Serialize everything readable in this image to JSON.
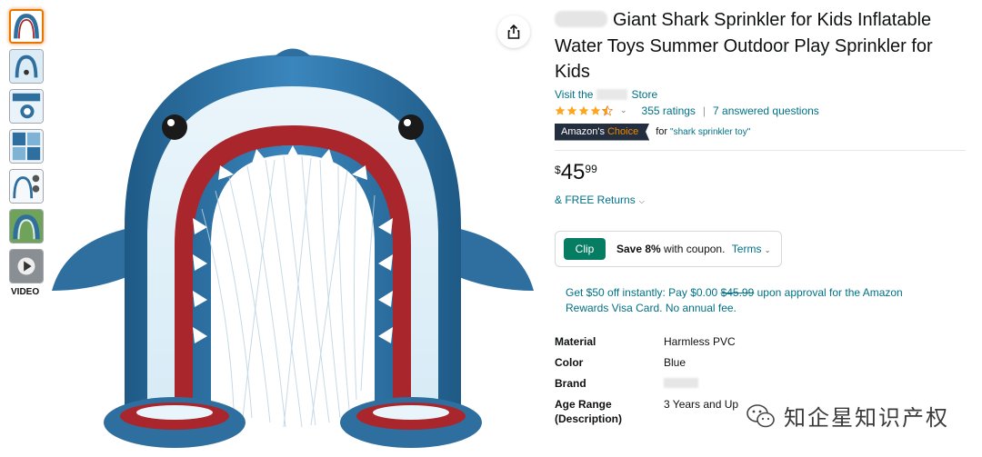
{
  "thumbnails": {
    "video_label": "VIDEO"
  },
  "product": {
    "title": "Giant Shark Sprinkler for Kids Inflatable Water Toys Summer Outdoor Play Sprinkler for Kids",
    "store_prefix": "Visit the",
    "store_suffix": "Store",
    "rating_value": 4.5,
    "ratings_count": "355 ratings",
    "answered": "7 answered questions",
    "badge_main": "Amazon's",
    "badge_accent": "Choice",
    "badge_for": "for",
    "badge_keyword": "\"shark sprinkler toy\"",
    "price_symbol": "$",
    "price_whole": "45",
    "price_fraction": "99",
    "returns": "& FREE Returns",
    "clip_label": "Clip",
    "coupon_bold": "Save 8%",
    "coupon_rest": "with coupon.",
    "terms": "Terms",
    "promo_part1": "Get $50 off instantly: Pay $0.00",
    "promo_strike": "$45.99",
    "promo_part2": "upon approval for the Amazon Rewards Visa Card. No annual fee."
  },
  "specs": [
    {
      "key": "Material",
      "value": "Harmless PVC"
    },
    {
      "key": "Color",
      "value": "Blue"
    },
    {
      "key": "Brand",
      "value": ""
    },
    {
      "key": "Age Range (Description)",
      "value": "3 Years and Up"
    }
  ],
  "watermark": {
    "text": "知企星知识产权"
  },
  "colors": {
    "link": "#007185",
    "badge_bg": "#232f3e",
    "badge_accent": "#f08804",
    "clip_bg": "#067d62",
    "star": "#ffa41c",
    "shark_blue": "#2f6f9f",
    "shark_mouth": "#a8262c"
  }
}
